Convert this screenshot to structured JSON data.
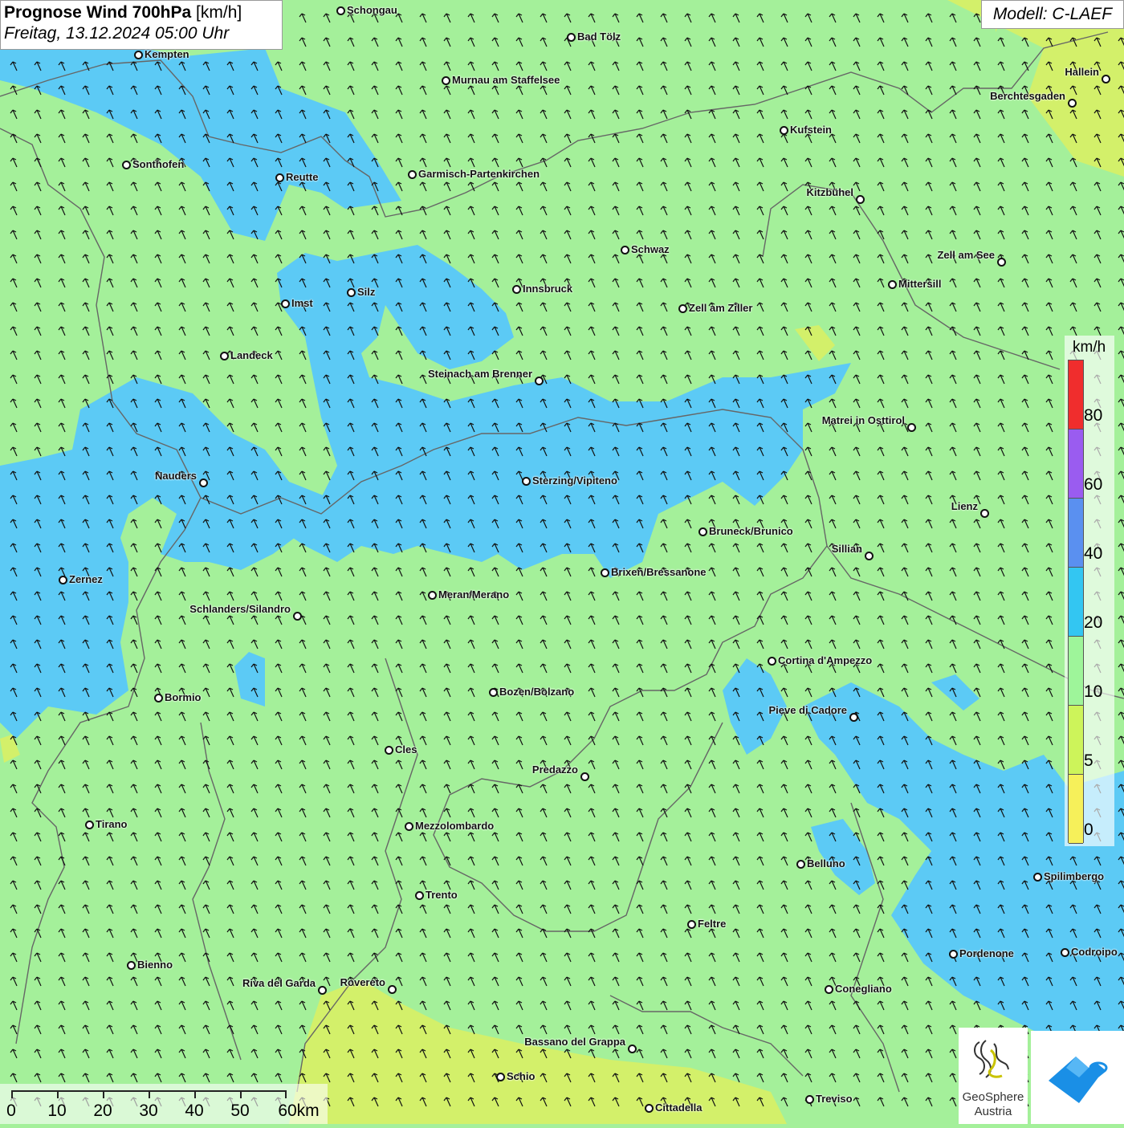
{
  "header": {
    "title_bold": "Prognose Wind 700hPa",
    "title_unit": "[km/h]",
    "subtitle": "Freitag, 13.12.2024 05:00 Uhr"
  },
  "model": "Modell: C-LAEF",
  "legend": {
    "unit": "km/h",
    "bands": [
      {
        "label": "80",
        "color": "#f02d2d"
      },
      {
        "label": "60",
        "color": "#9a5cf0"
      },
      {
        "label": "40",
        "color": "#5a90f0"
      },
      {
        "label": "20",
        "color": "#33c6f2"
      },
      {
        "label": "10",
        "color": "#9ef59a"
      },
      {
        "label": "5",
        "color": "#cdf45a"
      },
      {
        "label": "0",
        "color": "#f6f05a"
      }
    ]
  },
  "colors": {
    "background": "#a4f09a",
    "wind_area": "#5ccaf5",
    "calm_area": "#d3f06a",
    "border": "#666666",
    "arrow": "#111111"
  },
  "scale": {
    "labels": [
      "0",
      "10",
      "20",
      "30",
      "40",
      "50",
      "60km"
    ]
  },
  "logos": {
    "geosphere_line1": "GeoSphere",
    "geosphere_line2": "Austria"
  },
  "wind_direction": "from south-east (arrows pointing north-west)",
  "cities": [
    {
      "name": "Schongau"
    },
    {
      "name": "Bad Tölz"
    },
    {
      "name": "Kempten"
    },
    {
      "name": "Murnau am Staffelsee"
    },
    {
      "name": "Hallein"
    },
    {
      "name": "Berchtesgaden"
    },
    {
      "name": "Kufstein"
    },
    {
      "name": "Sonthofen"
    },
    {
      "name": "Reutte"
    },
    {
      "name": "Garmisch-Partenkirchen"
    },
    {
      "name": "Kitzbühel"
    },
    {
      "name": "Schwaz"
    },
    {
      "name": "Zell am See"
    },
    {
      "name": "Mittersill"
    },
    {
      "name": "Silz"
    },
    {
      "name": "Innsbruck"
    },
    {
      "name": "Imst"
    },
    {
      "name": "Zell am Ziller"
    },
    {
      "name": "Landeck"
    },
    {
      "name": "Steinach am Brenner"
    },
    {
      "name": "Matrei in Osttirol"
    },
    {
      "name": "Nauders"
    },
    {
      "name": "Sterzing/Vipiteno"
    },
    {
      "name": "Lienz"
    },
    {
      "name": "Bruneck/Brunico"
    },
    {
      "name": "Sillian"
    },
    {
      "name": "Zernez"
    },
    {
      "name": "Brixen/Bressanone"
    },
    {
      "name": "Meran/Merano"
    },
    {
      "name": "Schlanders/Silandro"
    },
    {
      "name": "Cortina d'Ampezzo"
    },
    {
      "name": "Bozen/Bolzano"
    },
    {
      "name": "Bormio"
    },
    {
      "name": "Pieve di Cadore"
    },
    {
      "name": "Cles"
    },
    {
      "name": "Predazzo"
    },
    {
      "name": "Tirano"
    },
    {
      "name": "Mezzolombardo"
    },
    {
      "name": "Belluno"
    },
    {
      "name": "Spilimbergo"
    },
    {
      "name": "Trento"
    },
    {
      "name": "Feltre"
    },
    {
      "name": "Pordenone"
    },
    {
      "name": "Codroipo"
    },
    {
      "name": "Bienno"
    },
    {
      "name": "Riva del Garda"
    },
    {
      "name": "Rovereto"
    },
    {
      "name": "Conegliano"
    },
    {
      "name": "Bassano del Grappa"
    },
    {
      "name": "Schio"
    },
    {
      "name": "Treviso"
    },
    {
      "name": "Cittadella"
    }
  ]
}
